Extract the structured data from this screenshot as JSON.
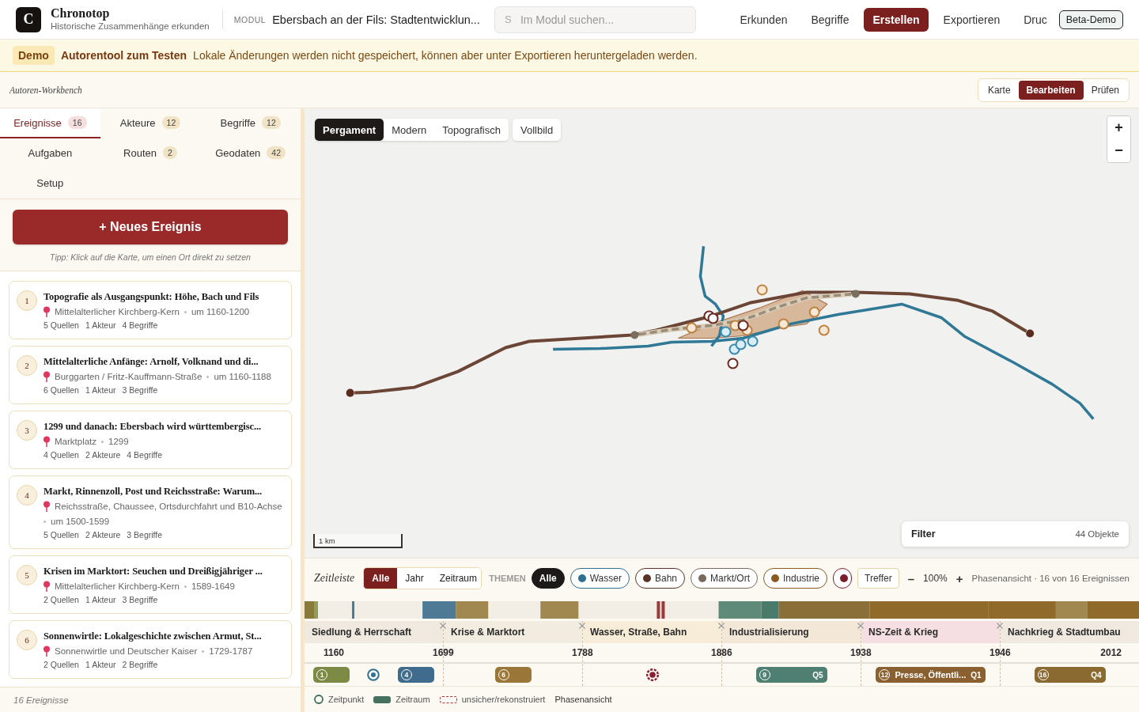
{
  "header": {
    "logo": "C",
    "title": "Chronotop",
    "subtitle": "Historische Zusammenhänge erkunden",
    "module_label": "MODUL",
    "module_name": "Ebersbach an der Fils: Stadtentwicklun...",
    "search": {
      "prefix": "S",
      "placeholder": "Im Modul suchen..."
    },
    "nav": [
      {
        "label": "Erkunden",
        "selected": false
      },
      {
        "label": "Begriffe",
        "selected": false
      },
      {
        "label": "Erstellen",
        "selected": true
      },
      {
        "label": "Exportieren",
        "selected": false
      },
      {
        "label": "Druc",
        "selected": false
      }
    ],
    "badge": "Beta-Demo"
  },
  "banner": {
    "tag": "Demo",
    "title": "Autorentool zum Testen",
    "message": "Lokale Änderungen werden nicht gespeichert, können aber unter Exportieren heruntergeladen werden."
  },
  "workbench": {
    "title": "Autoren-Workbench",
    "modes": [
      {
        "label": "Karte",
        "selected": false
      },
      {
        "label": "Bearbeiten",
        "selected": true
      },
      {
        "label": "Prüfen",
        "selected": false
      }
    ]
  },
  "sidebar": {
    "tabs": [
      {
        "label": "Ereignisse",
        "count": "16",
        "selected": true
      },
      {
        "label": "Akteure",
        "count": "12",
        "selected": false
      },
      {
        "label": "Begriffe",
        "count": "12",
        "selected": false
      },
      {
        "label": "Aufgaben",
        "selected": false
      },
      {
        "label": "Routen",
        "count": "2",
        "selected": false
      },
      {
        "label": "Geodaten",
        "count": "42",
        "selected": false
      },
      {
        "label": "Setup",
        "selected": false
      }
    ],
    "new_button": "+ Neues Ereignis",
    "tip": "Tipp: Klick auf die Karte, um einen Ort direkt zu setzen",
    "events": [
      {
        "number": "1",
        "title": "Topografie als Ausgangspunkt: Höhe, Bach und Fils",
        "place": "Mittelalterlicher Kirchberg-Kern",
        "date": "um 1160-1200",
        "meta": [
          "5 Quellen",
          "1 Akteur",
          "4 Begriffe"
        ]
      },
      {
        "number": "2",
        "title": "Mittelalterliche Anfänge: Arnolf, Volknand und di...",
        "place": "Burggarten / Fritz-Kauffmann-Straße",
        "date": "um 1160-1188",
        "meta": [
          "6 Quellen",
          "1 Akteur",
          "3 Begriffe"
        ]
      },
      {
        "number": "3",
        "title": "1299 und danach: Ebersbach wird württembergisc...",
        "place": "Marktplatz",
        "date": "1299",
        "meta": [
          "4 Quellen",
          "2 Akteure",
          "4 Begriffe"
        ]
      },
      {
        "number": "4",
        "title": "Markt, Rinnenzoll, Post und Reichsstraße: Warum...",
        "place": "Reichsstraße, Chaussee, Ortsdurchfahrt und B10-Achse",
        "date": "um 1500-1599",
        "meta": [
          "5 Quellen",
          "2 Akteure",
          "3 Begriffe"
        ]
      },
      {
        "number": "5",
        "title": "Krisen im Marktort: Seuchen und Dreißigjähriger ...",
        "place": "Mittelalterlicher Kirchberg-Kern",
        "date": "1589-1649",
        "meta": [
          "2 Quellen",
          "1 Akteur",
          "3 Begriffe"
        ]
      },
      {
        "number": "6",
        "title": "Sonnenwirtle: Lokalgeschichte zwischen Armut, St...",
        "place": "Sonnenwirtle und Deutscher Kaiser",
        "date": "1729-1787",
        "meta": [
          "2 Quellen",
          "1 Akteur",
          "2 Begriffe"
        ]
      }
    ],
    "footer": "16 Ereignisse"
  },
  "map": {
    "basemaps": [
      {
        "label": "Pergament",
        "selected": true
      },
      {
        "label": "Modern",
        "selected": false
      },
      {
        "label": "Topografisch",
        "selected": false
      }
    ],
    "fullscreen": "Vollbild",
    "zoom_in": "+",
    "zoom_out": "−",
    "scale": "1 km",
    "filter": {
      "label": "Filter",
      "count": "44 Objekte"
    }
  },
  "timeline": {
    "title": "Zeitleiste",
    "scopes": [
      {
        "label": "Alle",
        "selected": true
      },
      {
        "label": "Jahr",
        "selected": false
      },
      {
        "label": "Zeitraum",
        "selected": false
      }
    ],
    "themes_label": "THEMEN",
    "themes": [
      {
        "label": "Alle",
        "selected": true
      },
      {
        "label": "Wasser",
        "color": "#2f6f8f",
        "selected": false
      },
      {
        "label": "Bahn",
        "color": "#5a3226",
        "selected": false
      },
      {
        "label": "Markt/Ort",
        "color": "#786a5a",
        "selected": false
      },
      {
        "label": "Industrie",
        "color": "#8a5a1e",
        "selected": false
      },
      {
        "color": "#7b1e2e",
        "selected": false
      }
    ],
    "hits_button": "Treffer",
    "zoom_out": "–",
    "zoom": "100%",
    "zoom_in": "+",
    "summary": "Phasenansicht · 16 von 16 Ereignissen",
    "phases": [
      {
        "name": "Siedlung & Herrschaft",
        "color": "#efe9df",
        "events": [
          {
            "kind": "span",
            "number": "1",
            "color": "#7d8a45"
          },
          {
            "kind": "point",
            "color": "#2f6f8f"
          },
          {
            "kind": "span",
            "number": "4",
            "color": "#3f6c8c"
          }
        ]
      },
      {
        "name": "Krise & Marktort",
        "color": "#f2ebe0",
        "events": [
          {
            "kind": "span",
            "number": "6",
            "color": "#9a7738"
          }
        ]
      },
      {
        "name": "Wasser, Straße, Bahn",
        "color": "#f7ecd8",
        "events": [
          {
            "kind": "uncertain",
            "color": "#8b1f2f"
          }
        ]
      },
      {
        "name": "Industrialisierung",
        "color": "#f3e8d8",
        "events": [
          {
            "kind": "span",
            "number": "9",
            "badge": "Q5",
            "color": "#4f7f70"
          }
        ]
      },
      {
        "name": "NS-Zeit & Krieg",
        "color": "#f5dfe2",
        "events": [
          {
            "kind": "span",
            "number": "12",
            "label": "Presse, Öffentli...",
            "badge": "Q1",
            "color": "#8b6030"
          }
        ]
      },
      {
        "name": "Nachkrieg & Stadtumbau",
        "color": "#efe9df",
        "events": [
          {
            "kind": "span",
            "number": "16",
            "badge": "Q4",
            "color": "#8a6a30"
          }
        ]
      }
    ],
    "ticks": [
      "1160",
      "1699",
      "1788",
      "1886",
      "1938",
      "1946",
      "2012"
    ],
    "legend": [
      {
        "kind": "point",
        "label": "Zeitpunkt"
      },
      {
        "kind": "span",
        "label": "Zeitraum"
      },
      {
        "kind": "uncertain",
        "label": "unsicher/rekonstruiert"
      },
      {
        "kind": "note",
        "label": "Phasenansicht"
      }
    ]
  }
}
